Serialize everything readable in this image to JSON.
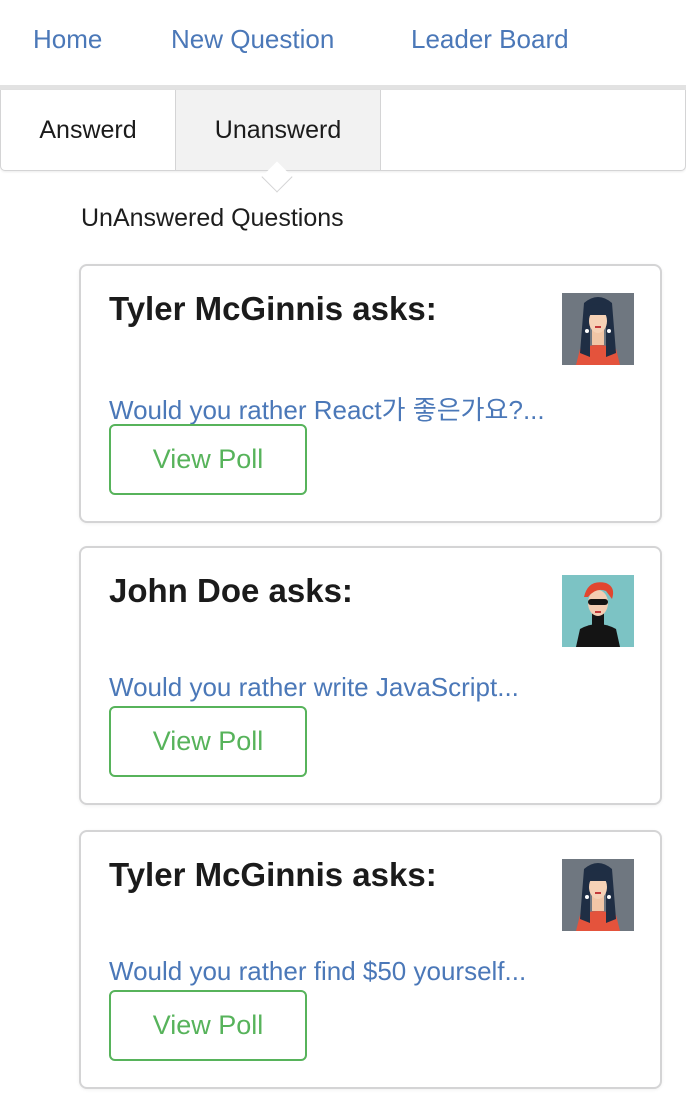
{
  "nav": {
    "home": "Home",
    "new_question": "New Question",
    "leader_board": "Leader Board"
  },
  "tabs": {
    "answered": "Answerd",
    "unanswered": "Unanswerd",
    "active": "unanswered"
  },
  "section_title": "UnAnswered Questions",
  "questions": [
    {
      "author": "Tyler McGinnis asks:",
      "avatar": "woman-dark-hair-avatar",
      "question": "Would you rather React가 좋은가요?...",
      "button": "View Poll"
    },
    {
      "author": "John Doe asks:",
      "avatar": "red-hair-sunglasses-avatar",
      "question": "Would you rather write JavaScript...",
      "button": "View Poll"
    },
    {
      "author": "Tyler McGinnis asks:",
      "avatar": "woman-dark-hair-avatar",
      "question": "Would you rather find $50 yourself...",
      "button": "View Poll"
    }
  ],
  "colors": {
    "link": "#4b78b8",
    "button": "#57b35b",
    "border": "#d4d4d5",
    "active_tab": "#f2f2f2"
  }
}
